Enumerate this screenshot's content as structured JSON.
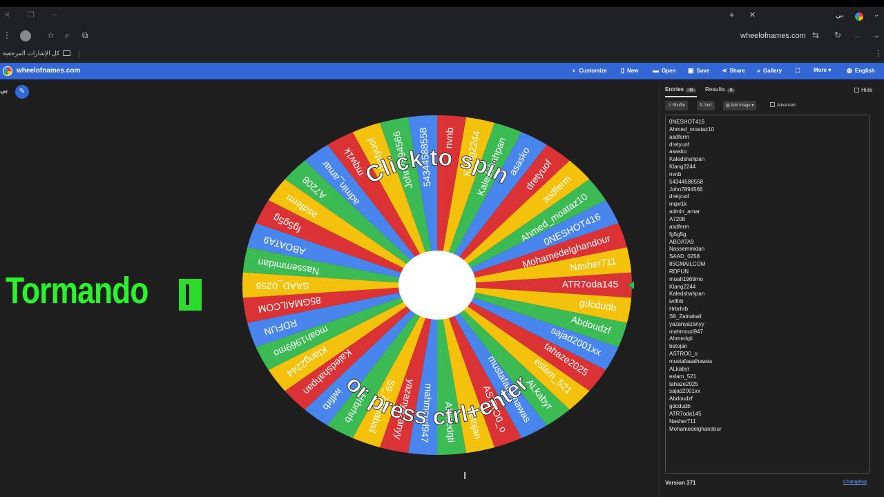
{
  "browser": {
    "tab_title": "بي",
    "address": "wheelofnames.com",
    "bookmarks_label": "كل الإشارات المرجعية"
  },
  "app": {
    "site_name": "wheelofnames.com",
    "menu": [
      {
        "label": "Customize",
        "icon": "palette-icon",
        "glyph": "◐"
      },
      {
        "label": "New",
        "icon": "new-file-icon",
        "glyph": "▯"
      },
      {
        "label": "Open",
        "icon": "folder-icon",
        "glyph": "▬"
      },
      {
        "label": "Save",
        "icon": "save-icon",
        "glyph": "▣"
      },
      {
        "label": "Share",
        "icon": "share-icon",
        "glyph": "⋖"
      },
      {
        "label": "Gallery",
        "icon": "search-icon",
        "glyph": "⌕"
      },
      {
        "label": "",
        "icon": "fullscreen-icon",
        "glyph": "⛶"
      },
      {
        "label": "More",
        "icon": "chevron-down-icon",
        "glyph": "▾"
      },
      {
        "label": "English",
        "icon": "globe-icon",
        "glyph": "◍"
      }
    ],
    "wheel_title": "بي"
  },
  "overlay_text": "Tormando",
  "wheel": {
    "center_text_top": "Click to spin",
    "center_text_bottom": "or press ctrl+enter",
    "colors": [
      "#db3236",
      "#f4c20d",
      "#3cba54",
      "#4885ed"
    ],
    "slices": [
      "ATR7oda145",
      "gdcdudb",
      "Abdoudzf",
      "sajad2001xx",
      "tahaze2025",
      "eslam_521",
      "ALkabyr",
      "mustafaaalhawas",
      "ASTRO0_o",
      "betojan",
      "Ahmedqti",
      "mahmoud947",
      "yazanyazanyy",
      "S9_Zalnabail",
      "Hrbrhrb",
      "iwlfirb",
      "Kaledshahpan",
      "Klang2244",
      "moah1969mo",
      "RDFUN",
      "85GMAILCOM",
      "SAAD_0258",
      "Nassemmidan",
      "ABOATA9",
      "fg5g5g",
      "asdferm",
      "A7208",
      "admin_amar",
      "mqw1k",
      "dretyuof",
      "John7894566",
      "54344588558",
      "nvnb",
      "Klang2244",
      "Kaledshahpan",
      "asasko",
      "dretyuof",
      "asdferm",
      "Ahmed_moataz10",
      "0NESHOT416",
      "Mohamedelghandour",
      "Nasher711"
    ]
  },
  "panel": {
    "tab_entries": "Entries",
    "entries_count": "42",
    "tab_results": "Results",
    "results_count": "0",
    "hide_label": "Hide",
    "shuffle_label": "Shuffle",
    "sort_label": "Sort",
    "add_image_label": "Add image",
    "advanced_label": "Advanced",
    "entries": [
      "0NESHOT416",
      "Ahmed_moataz10",
      "asdferm",
      "dretyuof",
      "asasko",
      "Kaledshahpan",
      "Klang2244",
      "nvnb",
      "54344588558",
      "John7894566",
      "dretyuof",
      "mqw1k",
      "admin_amar",
      "A7208",
      "asdferm",
      "fg5g5g",
      "ABOATA9",
      "Nassemmidan",
      "SAAD_0258",
      "85GMAILCOM",
      "RDFUN",
      "moah1969mo",
      "Klang2244",
      "Kaledshahpan",
      "iwlfirb",
      "Hrbrhrb",
      "S9_Zalnabail",
      "yazanyazanyy",
      "mahmoud947",
      "Ahmedqti",
      "betojan",
      "ASTRO0_o",
      "mustafaaalhawas",
      "ALkabyr",
      "eslam_521",
      "tahaze2025",
      "sajad2001xx",
      "Abdoudzf",
      "gdcdudb",
      "ATR7oda145",
      "Nasher711",
      "Mohamedelghandour"
    ],
    "version": "Version 371",
    "changelog": "Changelog"
  }
}
